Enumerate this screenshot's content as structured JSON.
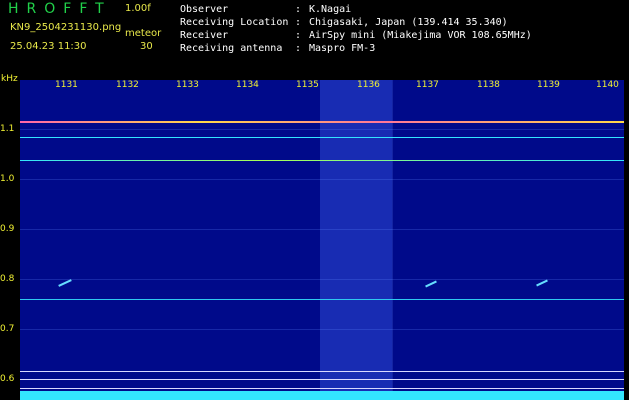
{
  "header": {
    "app_title": "HROFFT",
    "version": "1.00f",
    "file_name": "KN9_2504231130.png",
    "meteor_label": "meteor",
    "datetime": "25.04.23 11:30",
    "meteor_count": "30"
  },
  "info": [
    {
      "key": "Observer",
      "value": "K.Nagai"
    },
    {
      "key": "Receiving Location",
      "value": "Chigasaki, Japan (139.414 35.340)"
    },
    {
      "key": "Receiver",
      "value": "AirSpy mini (Miakejima VOR 108.65MHz)"
    },
    {
      "key": "Receiving antenna",
      "value": "Maspro FM-3"
    }
  ],
  "axis": {
    "unit": "kHz",
    "x_ticks": [
      "1131",
      "1132",
      "1133",
      "1134",
      "1135",
      "1136",
      "1137",
      "1138",
      "1139",
      "1140"
    ],
    "y_ticks": [
      "1.1",
      "1.0",
      "0.9",
      "0.8",
      "0.7",
      "0.6"
    ]
  },
  "colors": {
    "background": "#000000",
    "spectrum": "#000a8a",
    "label_yellow": "#f2f233",
    "logo_green": "#21d14a",
    "signal_cyan": "#33e5ff"
  }
}
